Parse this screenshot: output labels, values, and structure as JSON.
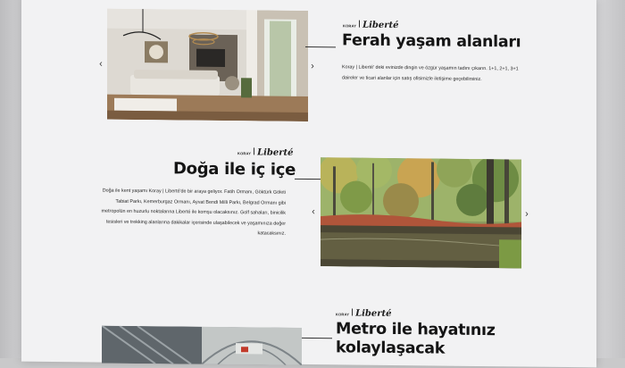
{
  "sections": [
    {
      "brand": {
        "small": "KORAY",
        "script": "Liberté"
      },
      "title": "Ferah yaşam alanları",
      "body": "Koray | Liberté' deki evinizde dingin ve özgür yaşamın tadını çıkarın. 1+1, 2+1, 3+1 daireler ve ticari alanlar için satış ofisimizle iletişime geçebilirsiniz.",
      "icons": {
        "prev": "chevron-left-icon",
        "next": "chevron-right-icon"
      },
      "prev_glyph": "‹",
      "next_glyph": "›"
    },
    {
      "brand": {
        "small": "KORAY",
        "script": "Liberté"
      },
      "title": "Doğa ile iç içe",
      "body": "Doğa ile kent yaşamı Koray | Liberté'de bir araya geliyor. Fatih Ormanı, Göktürk Göleti Tabiat Parkı, Kemerburgaz Ormanı, Ayvat Bendi Milli Parkı, Belgrad Ormanı gibi metropolün en huzurlu noktalarına Liberté ile komşu olacaksınız. Golf sahaları, binicilik tesisleri ve trekking alanlarına dakikalar içerisinde ulaşabilecek ve yaşamınıza değer katacaksınız.",
      "icons": {
        "prev": "chevron-left-icon",
        "next": "chevron-right-icon"
      },
      "prev_glyph": "‹",
      "next_glyph": "›"
    },
    {
      "brand": {
        "small": "KORAY",
        "script": "Liberté"
      },
      "title_line1": "Metro ile hayatınız",
      "title_line2": "kolaylaşacak"
    }
  ],
  "colors": {
    "page": "#f2f2f3",
    "backdrop": "#c9c9ca",
    "text": "#151515"
  }
}
